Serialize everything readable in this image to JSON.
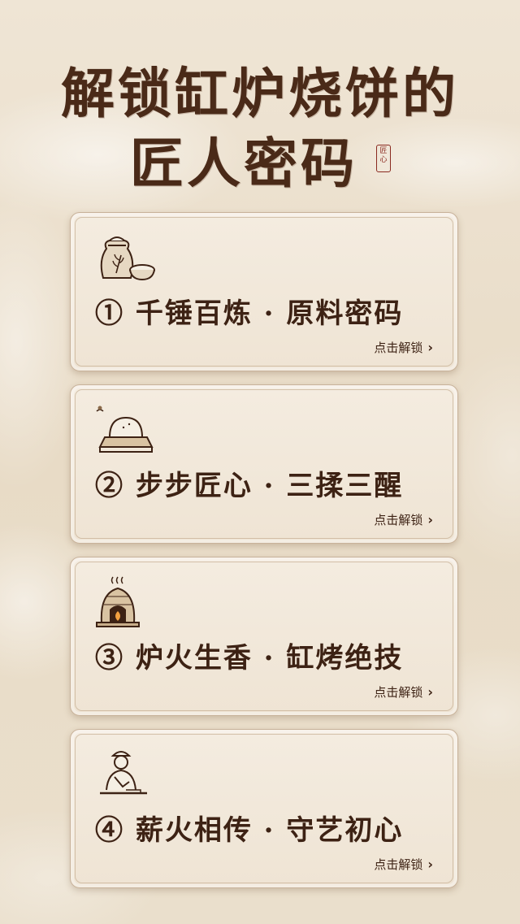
{
  "header": {
    "title_line1": "解锁缸炉烧饼的",
    "title_line2": "匠人密码",
    "seal_text": "匠心"
  },
  "cards": [
    {
      "label": "① 千锤百炼 · 原料密码",
      "action": "点击解锁",
      "icon": "flour-sack-icon"
    },
    {
      "label": "② 步步匠心 · 三揉三醒",
      "action": "点击解锁",
      "icon": "dough-board-icon"
    },
    {
      "label": "③ 炉火生香 · 缸烤绝技",
      "action": "点击解锁",
      "icon": "clay-oven-icon"
    },
    {
      "label": "④ 薪火相传 · 守艺初心",
      "action": "点击解锁",
      "icon": "baker-craftsman-icon"
    }
  ],
  "colors": {
    "title": "#4a2a18",
    "text": "#3d2214",
    "card_bg": "#f2e9dc",
    "border": "#c8b29a"
  }
}
